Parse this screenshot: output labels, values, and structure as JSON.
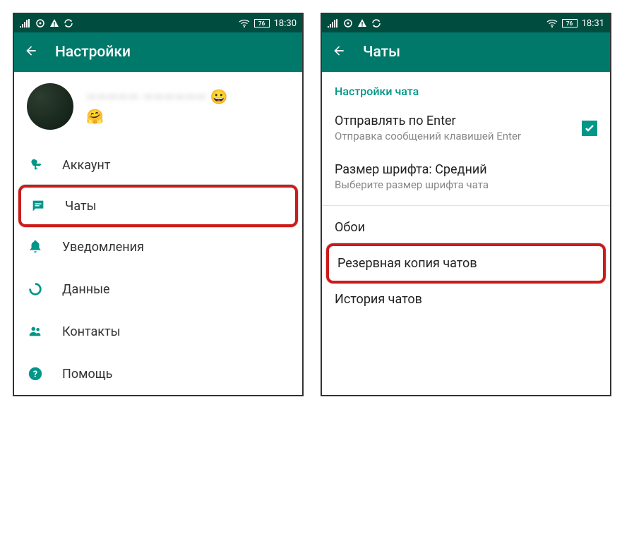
{
  "screens": {
    "left": {
      "status": {
        "battery": "76",
        "time": "18:30"
      },
      "appbar": {
        "title": "Настройки"
      },
      "profile": {
        "name_blurred": "—————  ——————",
        "emoji1": "😀",
        "emoji2": "🤗"
      },
      "menu": {
        "account": "Аккаунт",
        "chats": "Чаты",
        "notifications": "Уведомления",
        "data": "Данные",
        "contacts": "Контакты",
        "help": "Помощь"
      }
    },
    "right": {
      "status": {
        "battery": "76",
        "time": "18:31"
      },
      "appbar": {
        "title": "Чаты"
      },
      "section_header": "Настройки чата",
      "settings": {
        "enter_send": {
          "title": "Отправлять по Enter",
          "sub": "Отправка сообщений клавишей Enter"
        },
        "font_size": {
          "title": "Размер шрифта: Средний",
          "sub": "Выберите размер шрифта чата"
        },
        "wallpaper": {
          "title": "Обои"
        },
        "backup": {
          "title": "Резервная копия чатов"
        },
        "history": {
          "title": "История чатов"
        }
      }
    }
  }
}
